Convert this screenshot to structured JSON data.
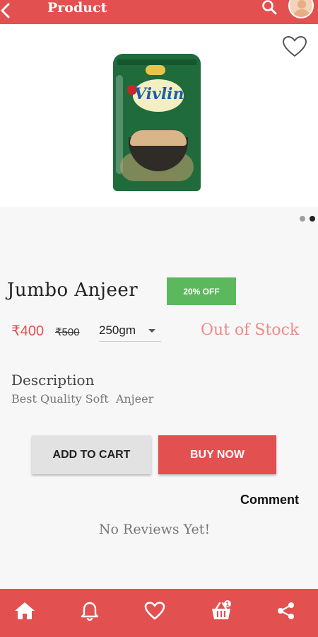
{
  "header": {
    "title": "Product",
    "icons": {
      "back": "back-arrow-icon",
      "search": "search-icon",
      "avatar": "avatar"
    }
  },
  "gallery": {
    "image_alt": "Vivlin",
    "dots_total": 2,
    "active_dot": 2
  },
  "product": {
    "name": "Jumbo Anjeer",
    "discount": "20% OFF",
    "price": "₹400",
    "mrp": "₹500",
    "variant": "250gm",
    "stock_status": "Out of Stock"
  },
  "description": {
    "heading": "Description",
    "text": "Best Quality Soft  Anjeer"
  },
  "actions": {
    "add_to_cart": "ADD TO CART",
    "buy_now": "BUY NOW"
  },
  "reviews": {
    "comment_label": "Comment",
    "empty_text": "No Reviews Yet!"
  },
  "bottom_nav": {
    "items": [
      "home-icon",
      "bell-icon",
      "heart-icon",
      "cart-icon",
      "share-icon"
    ],
    "cart_badge": "1"
  },
  "colors": {
    "primary": "#e35050",
    "discount": "#5cb85c",
    "stock": "#f08a8a"
  }
}
